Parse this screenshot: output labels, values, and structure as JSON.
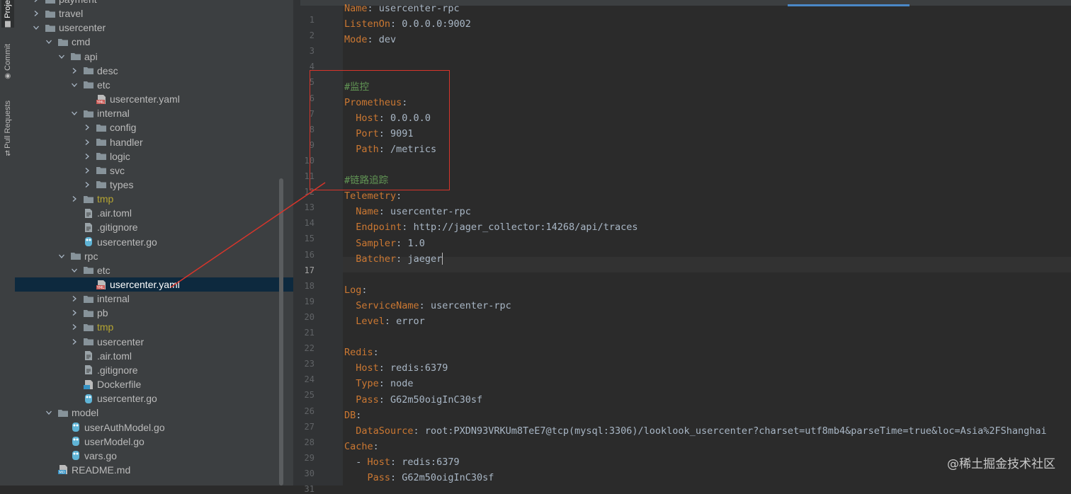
{
  "side_tabs": [
    {
      "label": "Proje",
      "icon": "folder-icon",
      "active": true
    },
    {
      "label": "Commit",
      "icon": "commit-icon",
      "active": false
    },
    {
      "label": "Pull Requests",
      "icon": "pull-request-icon",
      "active": false
    }
  ],
  "tree": [
    {
      "label": "payment",
      "depth": 1,
      "type": "folder",
      "state": "collapsed"
    },
    {
      "label": "travel",
      "depth": 1,
      "type": "folder",
      "state": "collapsed"
    },
    {
      "label": "usercenter",
      "depth": 1,
      "type": "folder",
      "state": "expanded"
    },
    {
      "label": "cmd",
      "depth": 2,
      "type": "folder",
      "state": "expanded"
    },
    {
      "label": "api",
      "depth": 3,
      "type": "folder",
      "state": "expanded"
    },
    {
      "label": "desc",
      "depth": 4,
      "type": "folder",
      "state": "collapsed"
    },
    {
      "label": "etc",
      "depth": 4,
      "type": "folder",
      "state": "expanded"
    },
    {
      "label": "usercenter.yaml",
      "depth": 5,
      "type": "yaml"
    },
    {
      "label": "internal",
      "depth": 4,
      "type": "folder",
      "state": "expanded"
    },
    {
      "label": "config",
      "depth": 5,
      "type": "folder",
      "state": "collapsed"
    },
    {
      "label": "handler",
      "depth": 5,
      "type": "folder",
      "state": "collapsed"
    },
    {
      "label": "logic",
      "depth": 5,
      "type": "folder",
      "state": "collapsed"
    },
    {
      "label": "svc",
      "depth": 5,
      "type": "folder",
      "state": "collapsed"
    },
    {
      "label": "types",
      "depth": 5,
      "type": "folder",
      "state": "collapsed"
    },
    {
      "label": "tmp",
      "depth": 4,
      "type": "folder-excluded",
      "state": "collapsed"
    },
    {
      "label": ".air.toml",
      "depth": 4,
      "type": "file"
    },
    {
      "label": ".gitignore",
      "depth": 4,
      "type": "file"
    },
    {
      "label": "usercenter.go",
      "depth": 4,
      "type": "go"
    },
    {
      "label": "rpc",
      "depth": 3,
      "type": "folder",
      "state": "expanded"
    },
    {
      "label": "etc",
      "depth": 4,
      "type": "folder",
      "state": "expanded"
    },
    {
      "label": "usercenter.yaml",
      "depth": 5,
      "type": "yaml",
      "selected": true
    },
    {
      "label": "internal",
      "depth": 4,
      "type": "folder",
      "state": "collapsed"
    },
    {
      "label": "pb",
      "depth": 4,
      "type": "folder",
      "state": "collapsed"
    },
    {
      "label": "tmp",
      "depth": 4,
      "type": "folder-excluded",
      "state": "collapsed"
    },
    {
      "label": "usercenter",
      "depth": 4,
      "type": "folder",
      "state": "collapsed"
    },
    {
      "label": ".air.toml",
      "depth": 4,
      "type": "file"
    },
    {
      "label": ".gitignore",
      "depth": 4,
      "type": "file"
    },
    {
      "label": "Dockerfile",
      "depth": 4,
      "type": "docker"
    },
    {
      "label": "usercenter.go",
      "depth": 4,
      "type": "go"
    },
    {
      "label": "model",
      "depth": 2,
      "type": "folder",
      "state": "expanded"
    },
    {
      "label": "userAuthModel.go",
      "depth": 3,
      "type": "go"
    },
    {
      "label": "userModel.go",
      "depth": 3,
      "type": "go"
    },
    {
      "label": "vars.go",
      "depth": 3,
      "type": "go"
    },
    {
      "label": "README.md",
      "depth": 2,
      "type": "md"
    }
  ],
  "editor": {
    "current_line": 17,
    "lines": [
      {
        "n": "1",
        "key": "Name",
        "sep": ": ",
        "val": "usercenter-rpc"
      },
      {
        "n": "2",
        "key": "ListenOn",
        "sep": ": ",
        "val": "0.0.0.0:9002"
      },
      {
        "n": "3",
        "key": "Mode",
        "sep": ": ",
        "val": "dev"
      },
      {
        "n": "4"
      },
      {
        "n": "5"
      },
      {
        "n": "6",
        "comment": "#监控"
      },
      {
        "n": "7",
        "key": "Prometheus",
        "sep": ":",
        "val": ""
      },
      {
        "n": "8",
        "indent": "  ",
        "key": "Host",
        "sep": ": ",
        "val": "0.0.0.0"
      },
      {
        "n": "9",
        "indent": "  ",
        "key": "Port",
        "sep": ": ",
        "val": "9091"
      },
      {
        "n": "10",
        "indent": "  ",
        "key": "Path",
        "sep": ": ",
        "val": "/metrics"
      },
      {
        "n": "11"
      },
      {
        "n": "12",
        "comment": "#链路追踪"
      },
      {
        "n": "13",
        "key": "Telemetry",
        "sep": ":",
        "val": ""
      },
      {
        "n": "14",
        "indent": "  ",
        "key": "Name",
        "sep": ": ",
        "val": "usercenter-rpc"
      },
      {
        "n": "15",
        "indent": "  ",
        "key": "Endpoint",
        "sep": ": ",
        "val": "http://jager_collector:14268/api/traces"
      },
      {
        "n": "16",
        "indent": "  ",
        "key": "Sampler",
        "sep": ": ",
        "val": "1.0"
      },
      {
        "n": "17",
        "indent": "  ",
        "key": "Batcher",
        "sep": ": ",
        "val": "jaeger",
        "caret": true
      },
      {
        "n": "18"
      },
      {
        "n": "19",
        "key": "Log",
        "sep": ":",
        "val": ""
      },
      {
        "n": "20",
        "indent": "  ",
        "key": "ServiceName",
        "sep": ": ",
        "val": "usercenter-rpc"
      },
      {
        "n": "21",
        "indent": "  ",
        "key": "Level",
        "sep": ": ",
        "val": "error"
      },
      {
        "n": "22"
      },
      {
        "n": "23",
        "key": "Redis",
        "sep": ":",
        "val": ""
      },
      {
        "n": "24",
        "indent": "  ",
        "key": "Host",
        "sep": ": ",
        "val": "redis:6379"
      },
      {
        "n": "25",
        "indent": "  ",
        "key": "Type",
        "sep": ": ",
        "val": "node"
      },
      {
        "n": "26",
        "indent": "  ",
        "key": "Pass",
        "sep": ": ",
        "val": "G62m50oigInC30sf"
      },
      {
        "n": "27",
        "key": "DB",
        "sep": ":",
        "val": ""
      },
      {
        "n": "28",
        "indent": "  ",
        "key": "DataSource",
        "sep": ": ",
        "val": "root:PXDN93VRKUm8TeE7@tcp(mysql:3306)/looklook_usercenter?charset=utf8mb4&parseTime=true&loc=Asia%2FShanghai"
      },
      {
        "n": "29",
        "key": "Cache",
        "sep": ":",
        "val": ""
      },
      {
        "n": "30",
        "indent": "  - ",
        "key": "Host",
        "sep": ": ",
        "val": "redis:6379"
      },
      {
        "n": "31",
        "indent": "    ",
        "key": "Pass",
        "sep": ": ",
        "val": "G62m50oigInC30sf"
      }
    ]
  },
  "watermark": "@稀土掘金技术社区",
  "colors": {
    "key": "#cc7832",
    "value": "#a9b7c6",
    "comment": "#629755",
    "annotation": "#d8352b",
    "selection": "#0d293e"
  }
}
